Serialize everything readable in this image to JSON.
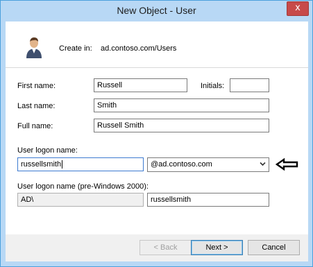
{
  "window": {
    "title": "New Object - User",
    "close_glyph": "x"
  },
  "header": {
    "create_in_label": "Create in:",
    "create_in_value": "ad.contoso.com/Users",
    "icon": "user-icon"
  },
  "form": {
    "first_name": {
      "label": "First name:",
      "value": "Russell"
    },
    "initials": {
      "label": "Initials:",
      "value": ""
    },
    "last_name": {
      "label": "Last name:",
      "value": "Smith"
    },
    "full_name": {
      "label": "Full name:",
      "value": "Russell Smith"
    },
    "logon": {
      "label": "User logon name:",
      "value": "russellsmith",
      "domain_selected": "@ad.contoso.com"
    },
    "pre2000": {
      "label": "User logon name (pre-Windows 2000):",
      "domain_value": "AD\\",
      "value": "russellsmith"
    }
  },
  "buttons": {
    "back": "< Back",
    "next": "Next >",
    "cancel": "Cancel"
  },
  "colors": {
    "titlebar": "#b8d8f5",
    "close_button": "#c74a4a",
    "annotation_arrow": "#000000"
  }
}
